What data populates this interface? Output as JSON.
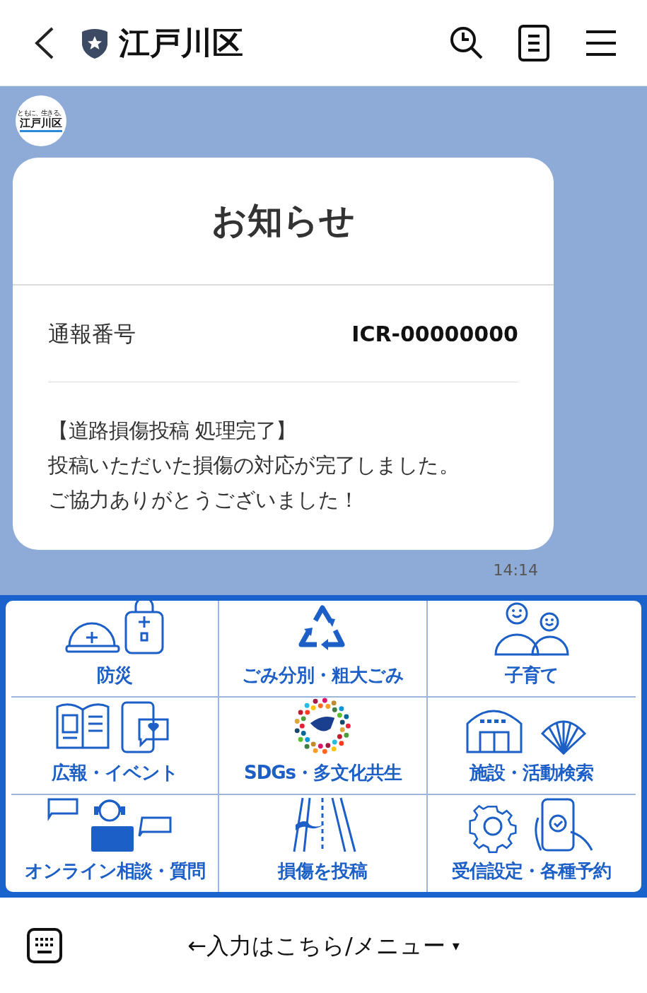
{
  "header": {
    "title": "江戸川区"
  },
  "chat": {
    "avatar": {
      "tagline": "ともに、生きる。",
      "name": "江戸川区"
    },
    "message": {
      "title": "お知らせ",
      "field_label": "通報番号",
      "field_value": "ICR-00000000",
      "body_lines": [
        "【道路損傷投稿 処理完了】",
        "投稿いただいた損傷の対応が完了しました。",
        "ご協力ありがとうございました！"
      ],
      "time": "14:14"
    }
  },
  "menu": {
    "items": [
      {
        "label": "防災",
        "kind": "disaster"
      },
      {
        "label": "ごみ分別・粗大ごみ",
        "kind": "recycle"
      },
      {
        "label": "子育て",
        "kind": "family"
      },
      {
        "label": "広報・イベント",
        "kind": "news"
      },
      {
        "label": "SDGs・多文化共生",
        "kind": "sdgs"
      },
      {
        "label": "施設・活動検索",
        "kind": "facility"
      },
      {
        "label": "オンライン相談・質問",
        "kind": "consult"
      },
      {
        "label": "損傷を投稿",
        "kind": "road"
      },
      {
        "label": "受信設定・各種予約",
        "kind": "settings"
      }
    ]
  },
  "input_bar": {
    "label": "←入力はこちら/メニュー",
    "caret": "▾"
  }
}
